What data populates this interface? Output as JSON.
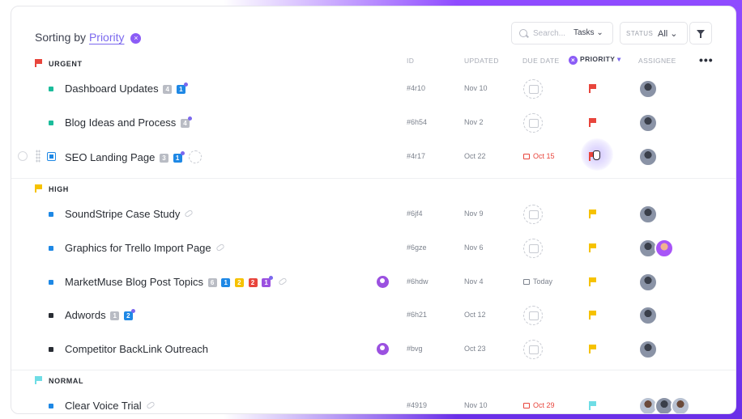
{
  "header": {
    "sort_prefix": "Sorting by",
    "sort_field": "Priority",
    "search_placeholder": "Search...",
    "search_scope": "Tasks",
    "status_label": "STATUS",
    "status_value": "All"
  },
  "columns": {
    "id": "ID",
    "updated": "UPDATED",
    "due_date": "DUE DATE",
    "priority": "PRIORITY",
    "assignee": "ASSIGNEE"
  },
  "groups": [
    {
      "label": "URGENT",
      "flag_color": "#e8453c",
      "tasks": [
        {
          "name": "Dashboard Updates",
          "id": "#4r10",
          "updated": "Nov 10",
          "due": "",
          "color": "#1bbc9b",
          "badges": [
            "4",
            "1"
          ]
        },
        {
          "name": "Blog Ideas and Process",
          "id": "#6h54",
          "updated": "Nov 2",
          "due": "",
          "color": "#1bbc9b",
          "badges": [
            "4"
          ]
        },
        {
          "name": "SEO Landing Page",
          "id": "#4r17",
          "updated": "Oct 22",
          "due": "Oct 15",
          "color": "#1e88e5",
          "badges": [
            "3",
            "1"
          ]
        }
      ]
    },
    {
      "label": "HIGH",
      "flag_color": "#f6c200",
      "tasks": [
        {
          "name": "SoundStripe Case Study",
          "id": "#6jf4",
          "updated": "Nov 9",
          "due": "",
          "color": "#1e88e5"
        },
        {
          "name": "Graphics for Trello Import Page",
          "id": "#6gze",
          "updated": "Nov 6",
          "due": "",
          "color": "#1e88e5"
        },
        {
          "name": "MarketMuse Blog Post Topics",
          "id": "#6hdw",
          "updated": "Nov 4",
          "due": "Today",
          "color": "#1e88e5",
          "badges": [
            "6",
            "1",
            "2",
            "2",
            "1"
          ]
        },
        {
          "name": "Adwords",
          "id": "#6h21",
          "updated": "Oct 12",
          "due": "",
          "color": "#292d34",
          "badges": [
            "1",
            "2"
          ]
        },
        {
          "name": "Competitor BackLink Outreach",
          "id": "#bvg",
          "updated": "Oct 23",
          "due": "",
          "color": "#292d34"
        }
      ]
    },
    {
      "label": "NORMAL",
      "flag_color": "#6fdde5",
      "tasks": [
        {
          "name": "Clear Voice Trial",
          "id": "#4919",
          "updated": "Nov 10",
          "due": "Oct 29",
          "color": "#1e88e5"
        }
      ]
    }
  ],
  "icons": {
    "sort_clear": "×",
    "priority_clear": "×",
    "more": "•••"
  }
}
